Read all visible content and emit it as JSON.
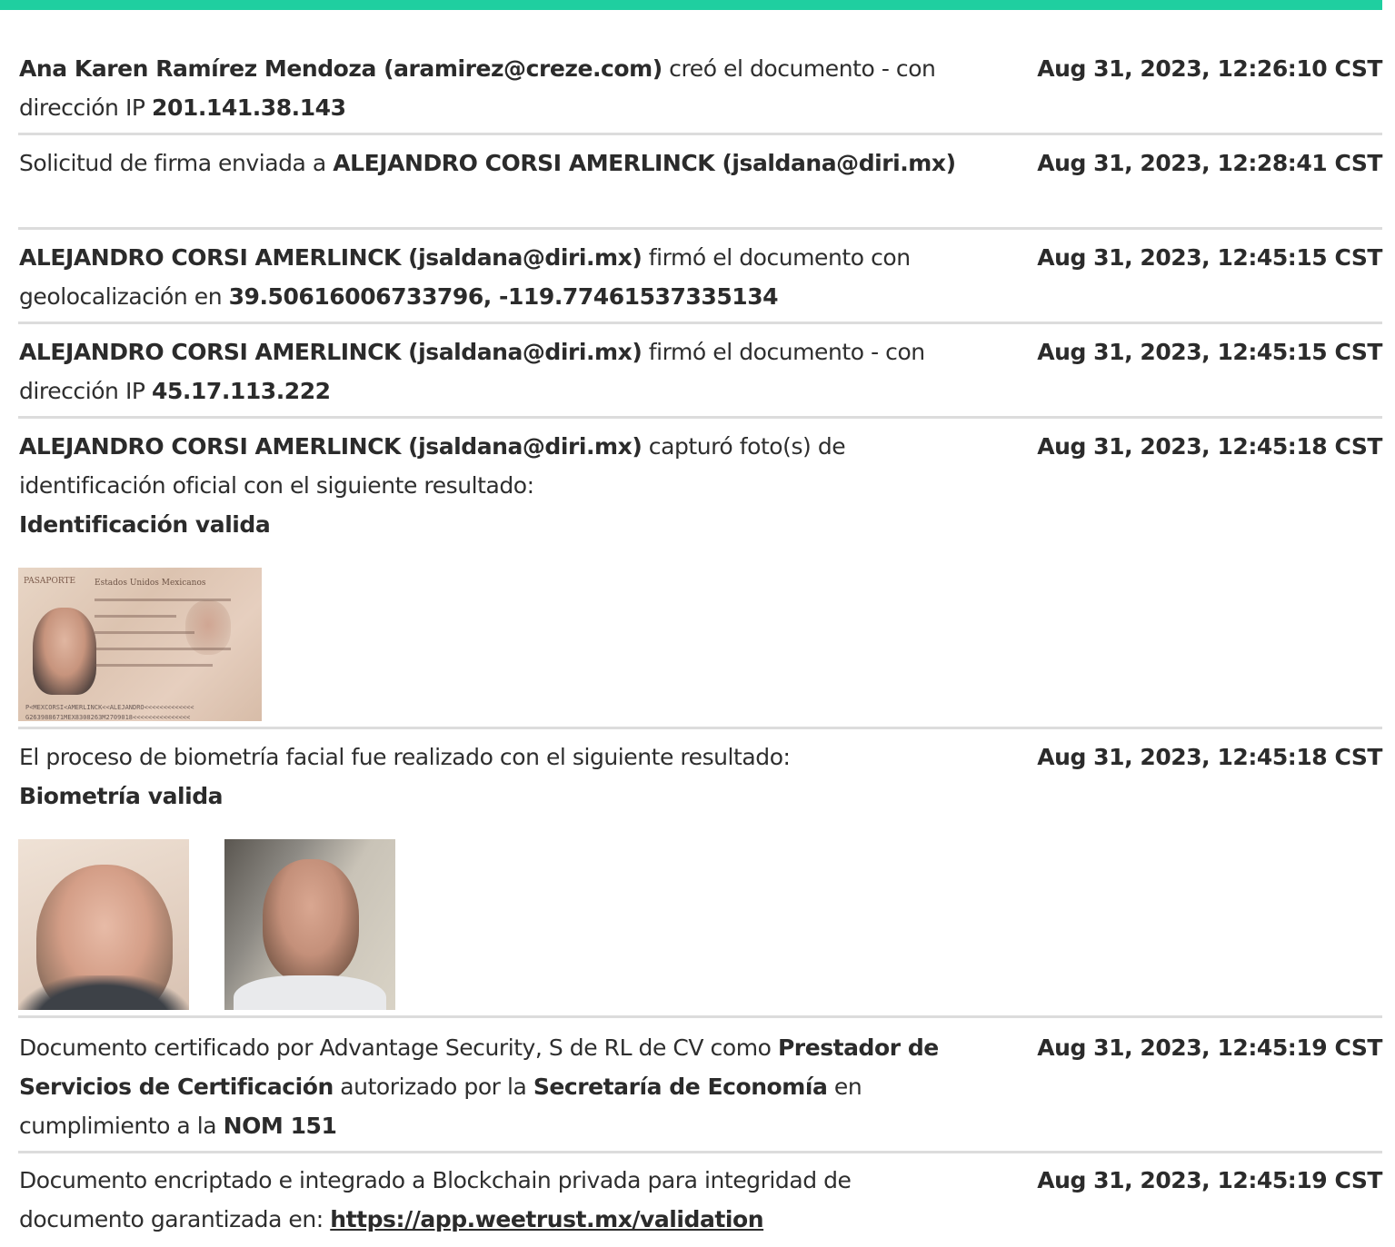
{
  "accent_color": "#1fcfa0",
  "events": [
    {
      "segments": [
        {
          "t": "Ana Karen Ramírez Mendoza (aramirez@creze.com)",
          "b": true
        },
        {
          "t": " creó el documento - con dirección IP ",
          "b": false
        },
        {
          "t": "201.141.38.143",
          "b": true
        }
      ],
      "timestamp": "Aug 31, 2023, 12:26:10 CST"
    },
    {
      "segments": [
        {
          "t": "Solicitud de firma enviada a ",
          "b": false
        },
        {
          "t": "ALEJANDRO CORSI AMERLINCK (jsaldana@diri.mx)",
          "b": true
        }
      ],
      "timestamp": "Aug 31, 2023, 12:28:41 CST"
    },
    {
      "segments": [
        {
          "t": "ALEJANDRO CORSI AMERLINCK (jsaldana@diri.mx)",
          "b": true
        },
        {
          "t": " firmó el documento con geolocalización en ",
          "b": false
        },
        {
          "t": "39.50616006733796, -119.77461537335134",
          "b": true
        }
      ],
      "timestamp": "Aug 31, 2023, 12:45:15 CST"
    },
    {
      "segments": [
        {
          "t": "ALEJANDRO CORSI AMERLINCK (jsaldana@diri.mx)",
          "b": true
        },
        {
          "t": " firmó el documento - con dirección IP ",
          "b": false
        },
        {
          "t": "45.17.113.222",
          "b": true
        }
      ],
      "timestamp": "Aug 31, 2023, 12:45:15 CST"
    },
    {
      "segments": [
        {
          "t": "ALEJANDRO CORSI AMERLINCK (jsaldana@diri.mx)",
          "b": true
        },
        {
          "t": " capturó foto(s) de identificación oficial con el siguiente resultado:",
          "b": false
        },
        {
          "br": true
        },
        {
          "t": "Identificación valida",
          "b": true
        }
      ],
      "timestamp": "Aug 31, 2023, 12:45:18 CST"
    },
    {
      "segments": [
        {
          "t": "El proceso de biometría facial fue realizado con el siguiente resultado:",
          "b": false
        },
        {
          "br": true
        },
        {
          "t": "Biometría valida",
          "b": true
        }
      ],
      "timestamp": "Aug 31, 2023, 12:45:18 CST"
    },
    {
      "segments": [
        {
          "t": "Documento certificado por Advantage Security, S de RL de CV como ",
          "b": false
        },
        {
          "t": "Prestador de Servicios de Certificación",
          "b": true
        },
        {
          "t": " autorizado por la ",
          "b": false
        },
        {
          "t": "Secretaría de Economía",
          "b": true
        },
        {
          "t": " en cumplimiento a la ",
          "b": false
        },
        {
          "t": "NOM 151",
          "b": true
        }
      ],
      "timestamp": "Aug 31, 2023, 12:45:19 CST"
    },
    {
      "segments": [
        {
          "t": "Documento encriptado e integrado a Blockchain privada para integridad de documento garantizada en: ",
          "b": false
        },
        {
          "t": "https://app.weetrust.mx/validation",
          "link": true
        }
      ],
      "timestamp": "Aug 31, 2023, 12:45:19 CST"
    }
  ],
  "passport": {
    "header": "PASAPORTE",
    "country": "Estados Unidos Mexicanos",
    "mrz1": "P<MEXCORSI<AMERLINCK<<ALEJANDRO<<<<<<<<<<<<<",
    "mrz2": "G263988671MEX8308263M2709018<<<<<<<<<<<<<<<"
  }
}
